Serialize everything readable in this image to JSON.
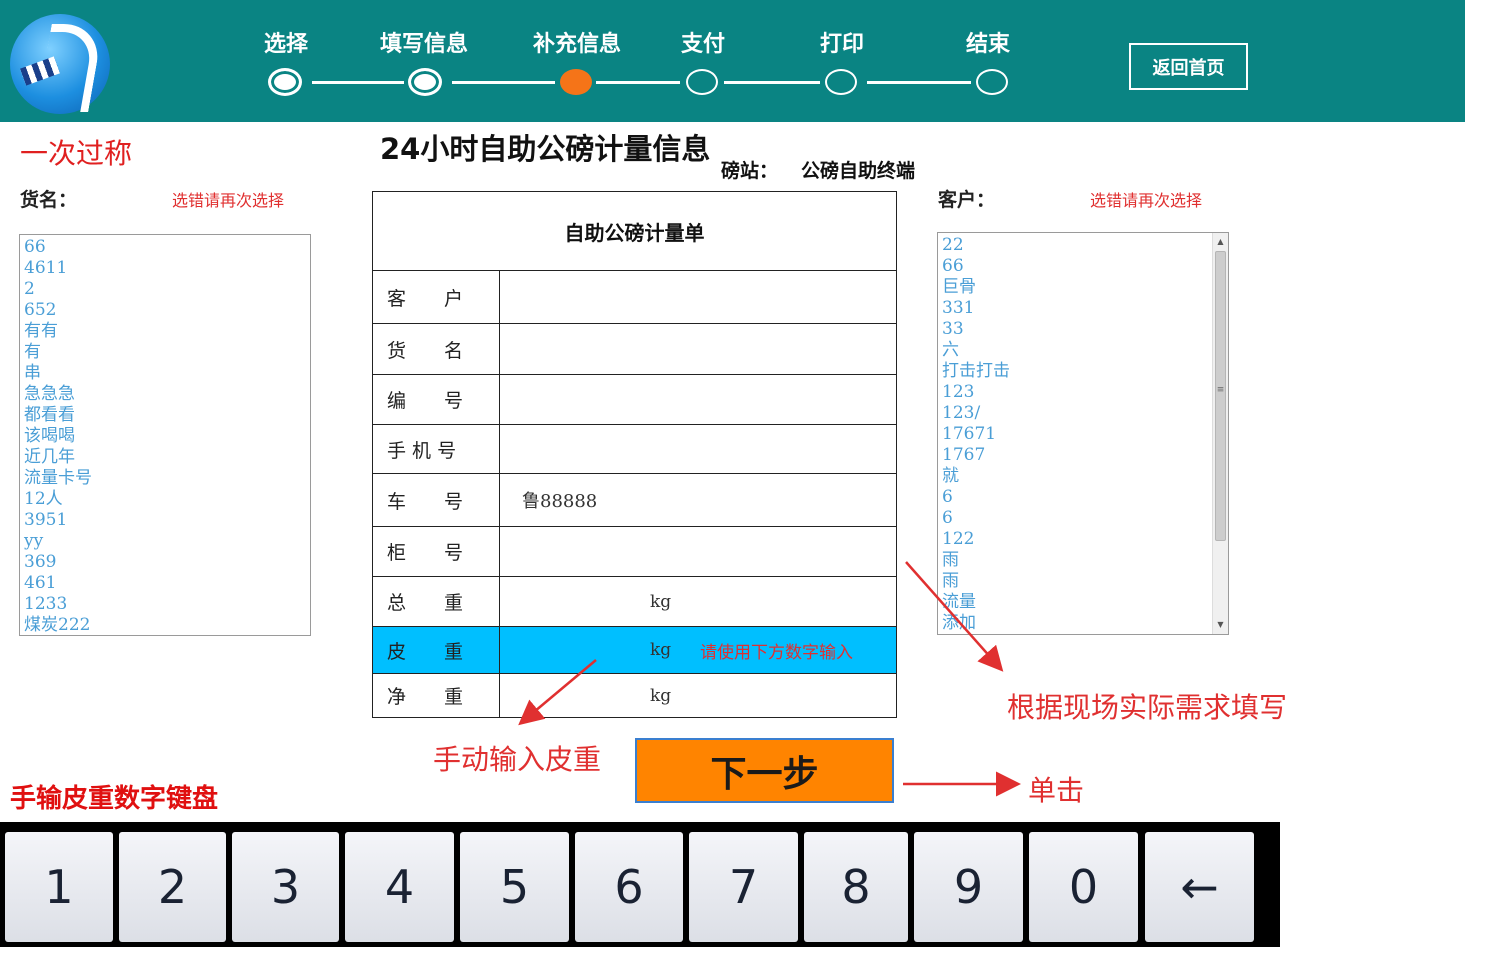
{
  "header": {
    "steps": [
      {
        "label": "选择",
        "state": "done"
      },
      {
        "label": "填写信息",
        "state": "done"
      },
      {
        "label": "补充信息",
        "state": "active"
      },
      {
        "label": "支付",
        "state": "pending"
      },
      {
        "label": "打印",
        "state": "pending"
      },
      {
        "label": "结束",
        "state": "pending"
      }
    ],
    "home_button": "返回首页",
    "colors": {
      "bar": "#0a8483",
      "active_step": "#f57418"
    }
  },
  "left": {
    "mode_title": "一次过称",
    "goods_label": "货名：",
    "goods_hint": "选错请再次选择",
    "goods_list": [
      "66",
      "4611",
      "2",
      "652",
      "有有",
      "有",
      "串",
      "急急急",
      "都看看",
      "该喝喝",
      "近几年",
      "流量卡号",
      "12人",
      "3951",
      "yy",
      "369",
      "461",
      "1233",
      "煤炭222"
    ]
  },
  "center": {
    "title": "24小时自助公磅计量信息",
    "station_label": "磅站：",
    "station_value": "公磅自助终端",
    "form_title": "自助公磅计量单",
    "rows": [
      {
        "label": "客　　户",
        "value": ""
      },
      {
        "label": "货　　名",
        "value": ""
      },
      {
        "label": "编　　号",
        "value": ""
      },
      {
        "label": "手 机 号",
        "value": ""
      },
      {
        "label": "车　　号",
        "value": "鲁88888"
      },
      {
        "label": "柜　　号",
        "value": ""
      },
      {
        "label": "总　　重",
        "unit": "kg"
      },
      {
        "label": "皮　　重",
        "unit": "kg",
        "hint": "请使用下方数字输入",
        "highlight_color": "#00bfff"
      },
      {
        "label": "净　　重",
        "unit": "kg"
      }
    ],
    "next_button": "下一步"
  },
  "right": {
    "customer_label": "客户：",
    "customer_hint": "选错请再次选择",
    "customer_list": [
      "22",
      "66",
      "巨骨",
      "331",
      "33",
      "六",
      "打击打击",
      "123",
      "123/",
      "17671",
      "1767",
      "就",
      "6",
      "6",
      "122",
      "雨",
      "雨",
      "流量",
      "添加"
    ]
  },
  "annotations": {
    "fill_by_need": "根据现场实际需求填写",
    "manual_tare": "手动输入皮重",
    "click": "单击",
    "keypad_title": "手输皮重数字键盘"
  },
  "keypad": {
    "keys": [
      "1",
      "2",
      "3",
      "4",
      "5",
      "6",
      "7",
      "8",
      "9",
      "0",
      "←"
    ]
  }
}
